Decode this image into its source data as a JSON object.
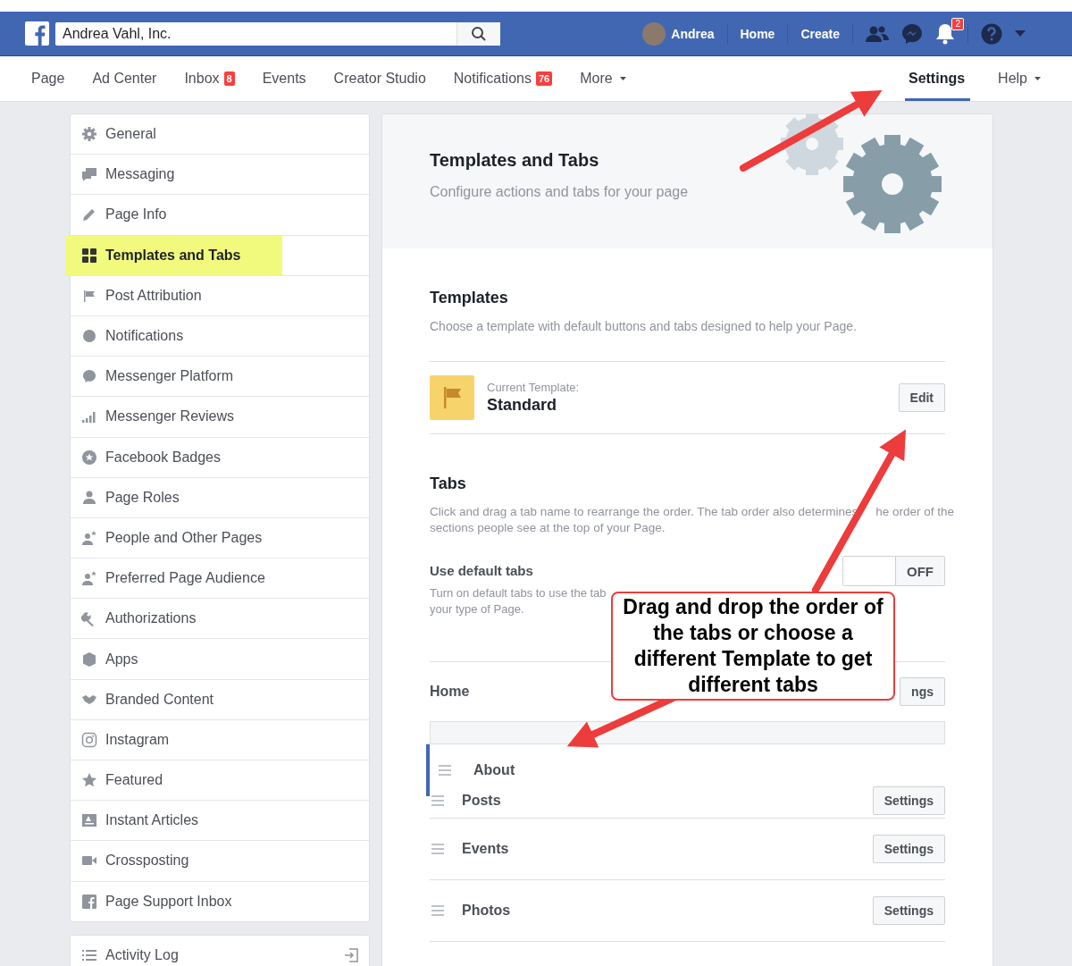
{
  "top_bar": {
    "search": {
      "value": "Andrea Vahl, Inc."
    },
    "user": "Andrea",
    "links": [
      "Home",
      "Create"
    ],
    "notification_badge": "2"
  },
  "page_nav": [
    {
      "label": "Page",
      "selected": false,
      "caret": false
    },
    {
      "label": "Ad Center",
      "selected": false,
      "caret": false
    },
    {
      "label": "Inbox",
      "badge": "8",
      "selected": false,
      "caret": false
    },
    {
      "label": "Events",
      "selected": false,
      "caret": false
    },
    {
      "label": "Creator Studio",
      "selected": false,
      "caret": false
    },
    {
      "label": "Notifications",
      "badge": "76",
      "selected": false,
      "caret": false
    },
    {
      "label": "More",
      "selected": false,
      "caret": true
    }
  ],
  "page_nav_right": [
    {
      "label": "Settings",
      "selected": true,
      "caret": false
    },
    {
      "label": "Help",
      "selected": false,
      "caret": true
    }
  ],
  "sidebar": {
    "items": [
      {
        "label": "General",
        "selected": false
      },
      {
        "label": "Messaging",
        "selected": false
      },
      {
        "label": "Page Info",
        "selected": false
      },
      {
        "label": "Templates and Tabs",
        "selected": true
      },
      {
        "label": "Post Attribution",
        "selected": false
      },
      {
        "label": "Notifications",
        "selected": false
      },
      {
        "label": "Messenger Platform",
        "selected": false
      },
      {
        "label": "Messenger Reviews",
        "selected": false
      },
      {
        "label": "Facebook Badges",
        "selected": false
      },
      {
        "label": "Page Roles",
        "selected": false
      },
      {
        "label": "People and Other Pages",
        "selected": false
      },
      {
        "label": "Preferred Page Audience",
        "selected": false
      },
      {
        "label": "Authorizations",
        "selected": false
      },
      {
        "label": "Apps",
        "selected": false
      },
      {
        "label": "Branded Content",
        "selected": false
      },
      {
        "label": "Instagram",
        "selected": false
      },
      {
        "label": "Featured",
        "selected": false
      },
      {
        "label": "Instant Articles",
        "selected": false
      },
      {
        "label": "Crossposting",
        "selected": false
      },
      {
        "label": "Page Support Inbox",
        "selected": false
      }
    ],
    "footer_item": {
      "label": "Activity Log"
    }
  },
  "header": {
    "title": "Templates and Tabs",
    "subtitle": "Configure actions and tabs for your page"
  },
  "templates": {
    "title": "Templates",
    "description": "Choose a template with default buttons and tabs designed to help your Page.",
    "current_label": "Current Template:",
    "current_value": "Standard",
    "button": "Edit"
  },
  "tabs_section": {
    "title": "Tabs",
    "description_parts": [
      "Click and drag a tab name to rearrange the order. The tab order also determines",
      "he order of the",
      "sections people see at the top of your Page."
    ],
    "default_tabs": {
      "label": "Use default tabs",
      "description_lines": [
        "Turn on default tabs to use the tab",
        "your type of Page."
      ],
      "toggle_label": "OFF",
      "on": false
    },
    "home": {
      "label": "Home",
      "button": "ngs"
    },
    "tabs": [
      {
        "label": "About",
        "dragging": true
      },
      {
        "label": "Posts",
        "dragging": false,
        "button": "Settings"
      },
      {
        "label": "Events",
        "dragging": false,
        "button": "Settings"
      },
      {
        "label": "Photos",
        "dragging": false,
        "button": "Settings"
      }
    ]
  },
  "callout": {
    "text": "Drag and drop the order of the tabs or choose a different Template to get different tabs"
  }
}
